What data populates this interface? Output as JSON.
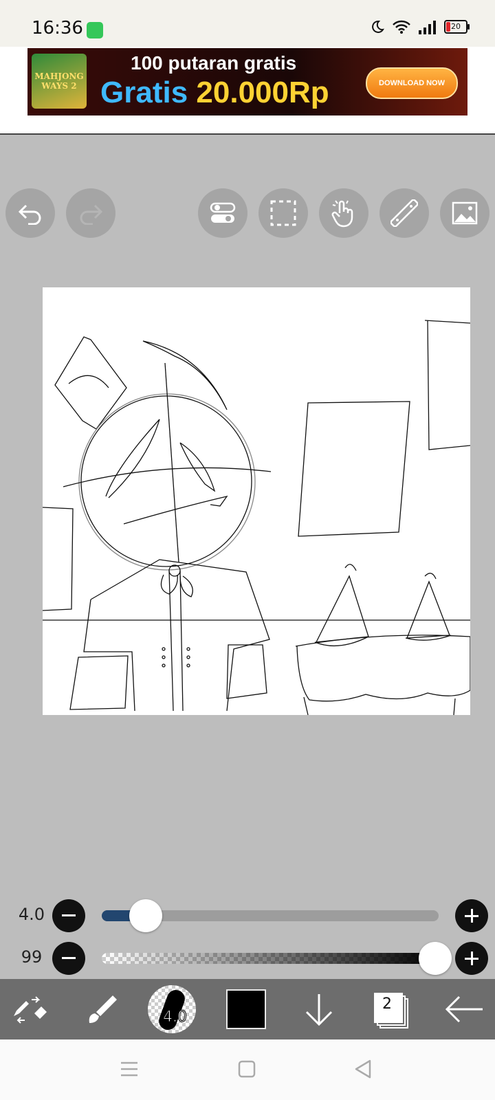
{
  "status_bar": {
    "time": "16:36",
    "battery": "20",
    "icons": [
      "battery-saver-icon",
      "moon-icon",
      "wifi-icon",
      "signal-icon",
      "battery-icon"
    ]
  },
  "ad": {
    "logo_text": "MAHJONG WAYS 2",
    "line1": "100 putaran gratis",
    "line2_a": "Gratis",
    "line2_b": "20.000Rp",
    "button": "DOWNLOAD NOW"
  },
  "top_toolbar": {
    "buttons": [
      "undo-icon",
      "redo-icon",
      "toggle-icon",
      "selection-icon",
      "hand-tool-icon",
      "ruler-icon",
      "image-import-icon"
    ]
  },
  "brush_size": {
    "value_label": "4.0",
    "fraction": 0.13
  },
  "opacity": {
    "value_label": "99",
    "fraction": 0.99
  },
  "bottom_bar": {
    "brush_preview_label": "4.0",
    "layer_count": "2",
    "current_color": "#000000",
    "items": [
      "tool-switch-icon",
      "brush-icon",
      "brush-preview",
      "color-swatch",
      "move-down-icon",
      "layers-icon",
      "back-arrow-icon"
    ]
  },
  "colors": {
    "workspace": "#bdbdbd",
    "slider_fill": "#22466f",
    "bottom_bar": "#6d6d6d"
  }
}
